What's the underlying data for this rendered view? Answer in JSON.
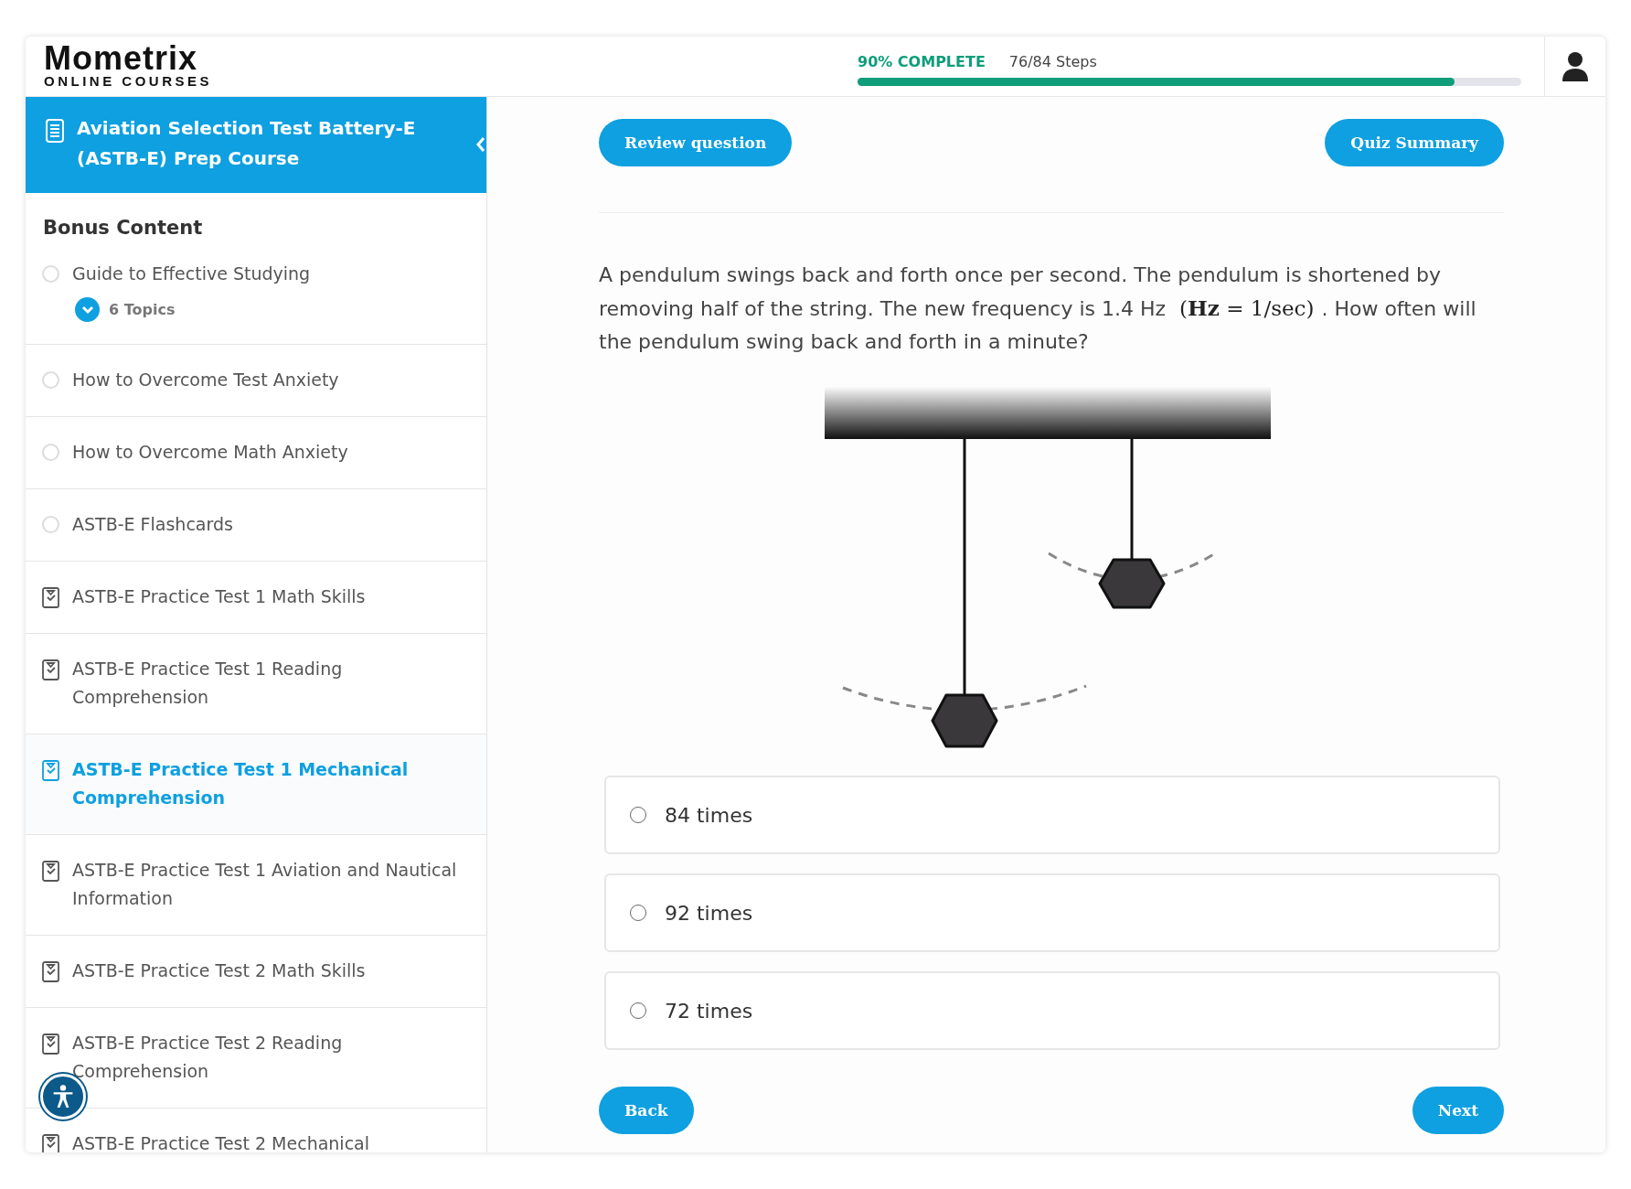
{
  "header": {
    "logo": "Mometrix",
    "logo_subtitle": "ONLINE COURSES",
    "progress": {
      "label": "90% COMPLETE",
      "steps": "76/84 Steps",
      "level": 0.9
    }
  },
  "sidebar": {
    "course_title": "Aviation Selection Test Battery-E (ASTB-E) Prep Course",
    "section_title": "Bonus Content",
    "items": [
      {
        "label": "Guide to Effective Studying",
        "kind": "lesson",
        "selected": false,
        "topics": "6 Topics"
      },
      {
        "label": "How to Overcome Test Anxiety",
        "kind": "lesson",
        "selected": false
      },
      {
        "label": "How to Overcome Math Anxiety",
        "kind": "lesson",
        "selected": false
      },
      {
        "label": "ASTB-E Flashcards",
        "kind": "lesson",
        "selected": false
      },
      {
        "label": "ASTB-E Practice Test 1 Math Skills",
        "kind": "quiz",
        "selected": false
      },
      {
        "label": "ASTB-E Practice Test 1 Reading Comprehension",
        "kind": "quiz",
        "selected": false
      },
      {
        "label": "ASTB-E Practice Test 1 Mechanical Comprehension",
        "kind": "quiz",
        "selected": true
      },
      {
        "label": "ASTB-E Practice Test 1 Aviation and Nautical Information",
        "kind": "quiz",
        "selected": false
      },
      {
        "label": "ASTB-E Practice Test 2 Math Skills",
        "kind": "quiz",
        "selected": false
      },
      {
        "label": "ASTB-E Practice Test 2 Reading Comprehension",
        "kind": "quiz",
        "selected": false
      },
      {
        "label": "ASTB-E Practice Test 2 Mechanical",
        "kind": "quiz",
        "selected": false
      }
    ]
  },
  "quiz": {
    "review_button": "Review question",
    "summary_button": "Quiz Summary",
    "question": {
      "text_before": "A pendulum swings back and forth once per second. The pendulum is shortened by removing half of the string. The new frequency is 1.4 Hz",
      "math": "(**Hz** = 1/sec)",
      "text_after": ". How often will the pendulum swing back and forth in a minute?"
    },
    "answers": [
      {
        "label": "84 times",
        "selected": false
      },
      {
        "label": "92 times",
        "selected": false
      },
      {
        "label": "72 times",
        "selected": false
      }
    ],
    "back_button": "Back",
    "next_button": "Next"
  }
}
